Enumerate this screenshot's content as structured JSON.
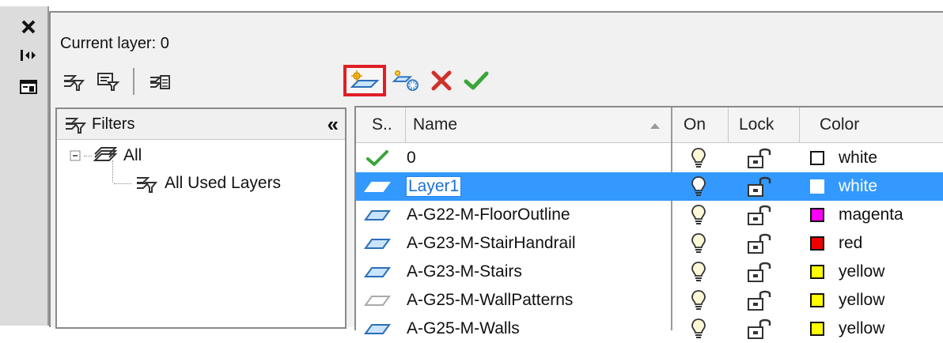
{
  "side_strip": {
    "icons": [
      "close-icon",
      "auto-hide-icon",
      "properties-icon"
    ]
  },
  "header": {
    "current_layer": "Current layer: 0"
  },
  "toolbar": {
    "left_icons": [
      "new-property-filter-icon",
      "new-group-filter-icon",
      "layer-states-manager-icon"
    ],
    "right_icons": [
      "new-layer-icon",
      "new-layer-vp-frozen-icon",
      "delete-layer-icon",
      "set-current-icon"
    ]
  },
  "filters": {
    "title": "Filters",
    "collapse_glyph": "«",
    "tree": [
      {
        "label": "All",
        "level": 0,
        "expanded": true
      },
      {
        "label": "All Used Layers",
        "level": 1
      }
    ]
  },
  "grid": {
    "columns": {
      "status": "S..",
      "name": "Name",
      "on": "On",
      "lock": "Lock",
      "color": "Color"
    },
    "rows": [
      {
        "status": "current",
        "name": "0",
        "color_name": "white",
        "color_hex": "#ffffff",
        "selected": false
      },
      {
        "status": "layer",
        "name": "Layer1",
        "color_name": "white",
        "color_hex": "#ffffff",
        "selected": true
      },
      {
        "status": "layer",
        "name": "A-G22-M-FloorOutline",
        "color_name": "magenta",
        "color_hex": "#ff00ff",
        "selected": false
      },
      {
        "status": "layer",
        "name": "A-G23-M-StairHandrail",
        "color_name": "red",
        "color_hex": "#ee0000",
        "selected": false
      },
      {
        "status": "layer",
        "name": "A-G23-M-Stairs",
        "color_name": "yellow",
        "color_hex": "#ffff00",
        "selected": false
      },
      {
        "status": "layer-empty",
        "name": "A-G25-M-WallPatterns",
        "color_name": "yellow",
        "color_hex": "#ffff00",
        "selected": false
      },
      {
        "status": "layer",
        "name": "A-G25-M-Walls",
        "color_name": "yellow",
        "color_hex": "#ffff00",
        "selected": false
      }
    ]
  },
  "colors": {
    "selection": "#3399ff",
    "highlight_box": "#e01e26",
    "check_green": "#3aa53a",
    "delete_red": "#d0302a"
  }
}
